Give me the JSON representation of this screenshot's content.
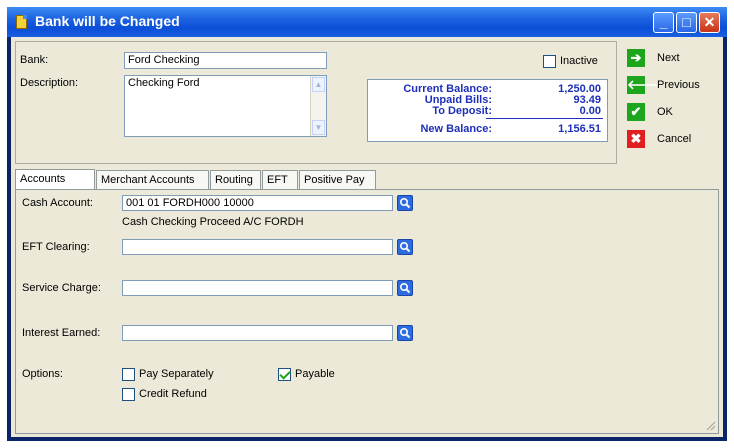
{
  "window": {
    "title": "Bank will be Changed"
  },
  "form": {
    "bank_label": "Bank:",
    "bank_value": "Ford Checking",
    "description_label": "Description:",
    "description_value": "Checking Ford",
    "inactive_label": "Inactive",
    "inactive_checked": false
  },
  "balance": {
    "current_label": "Current Balance:",
    "current_value": "1,250.00",
    "unpaid_label": "Unpaid Bills:",
    "unpaid_value": "93.49",
    "deposit_label": "To Deposit:",
    "deposit_value": "0.00",
    "new_label": "New Balance:",
    "new_value": "1,156.51"
  },
  "actions": {
    "next": "Next",
    "previous": "Previous",
    "ok": "OK",
    "cancel": "Cancel"
  },
  "tabs": [
    "Accounts",
    "Merchant Accounts",
    "Routing",
    "EFT",
    "Positive Pay"
  ],
  "accounts_tab": {
    "cash_account_label": "Cash Account:",
    "cash_account_value": "001 01 FORDH000 10000",
    "cash_account_desc": "Cash Checking Proceed A/C FORDH",
    "eft_clearing_label": "EFT Clearing:",
    "eft_clearing_value": "",
    "service_charge_label": "Service Charge:",
    "service_charge_value": "",
    "interest_earned_label": "Interest Earned:",
    "interest_earned_value": "",
    "options_label": "Options:",
    "pay_separately_label": "Pay Separately",
    "pay_separately_checked": false,
    "payable_label": "Payable",
    "payable_checked": true,
    "credit_refund_label": "Credit Refund",
    "credit_refund_checked": false
  },
  "colors": {
    "titlebar": "#0b4ed8",
    "balance_text": "#1d2fb8",
    "dialog_bg": "#ece9d8"
  }
}
